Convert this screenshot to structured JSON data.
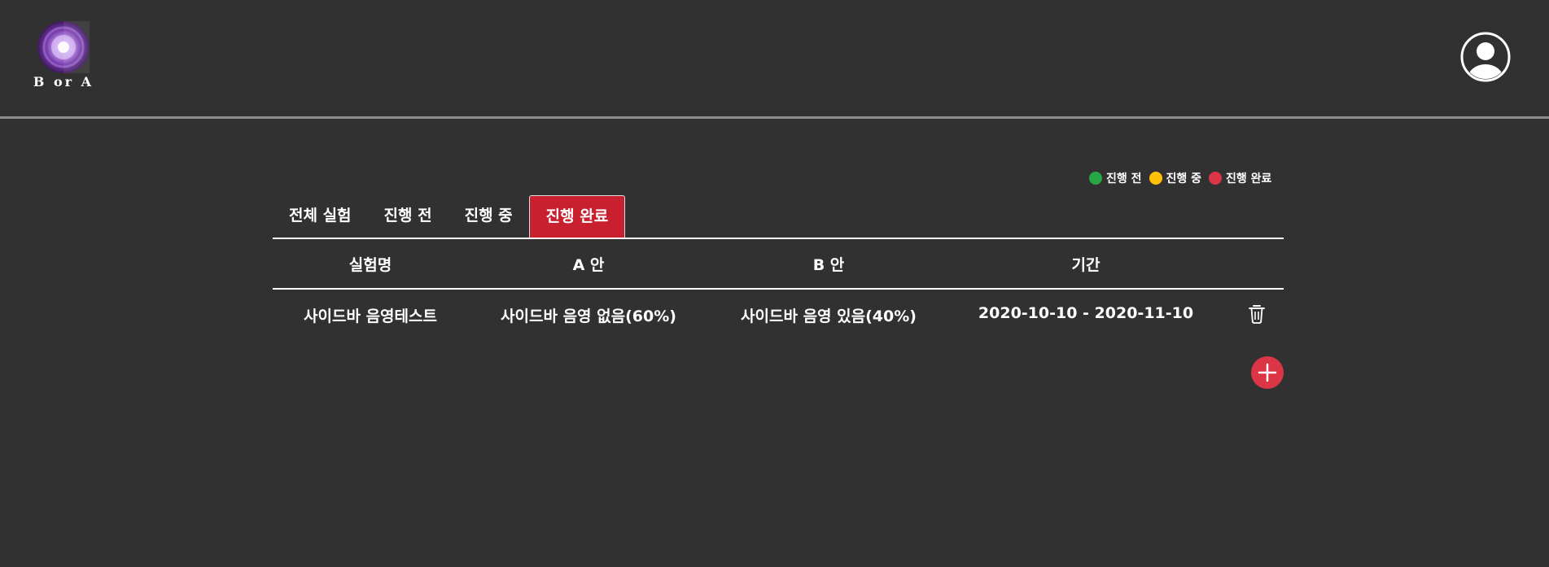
{
  "app": {
    "logo_text": "B or A"
  },
  "colors": {
    "background": "#313131",
    "active_tab": "#c8202f",
    "status_before": "#28a745",
    "status_in_progress": "#ffc107",
    "status_done": "#dc3545"
  },
  "legend": [
    {
      "label": "진행 전",
      "color": "#28a745"
    },
    {
      "label": "진행 중",
      "color": "#ffc107"
    },
    {
      "label": "진행 완료",
      "color": "#dc3545"
    }
  ],
  "tabs": [
    {
      "label": "전체 실험",
      "active": false
    },
    {
      "label": "진행 전",
      "active": false
    },
    {
      "label": "진행 중",
      "active": false
    },
    {
      "label": "진행 완료",
      "active": true
    }
  ],
  "table": {
    "headers": [
      "실험명",
      "A 안",
      "B 안",
      "기간"
    ],
    "rows": [
      [
        "사이드바 음영테스트",
        "사이드바 음영 없음(60%)",
        "사이드바 음영 있음(40%)",
        "2020-10-10 - 2020-11-10"
      ]
    ]
  },
  "icons": {
    "profile": "user-circle-icon",
    "delete": "trash-icon",
    "add": "plus-icon"
  }
}
